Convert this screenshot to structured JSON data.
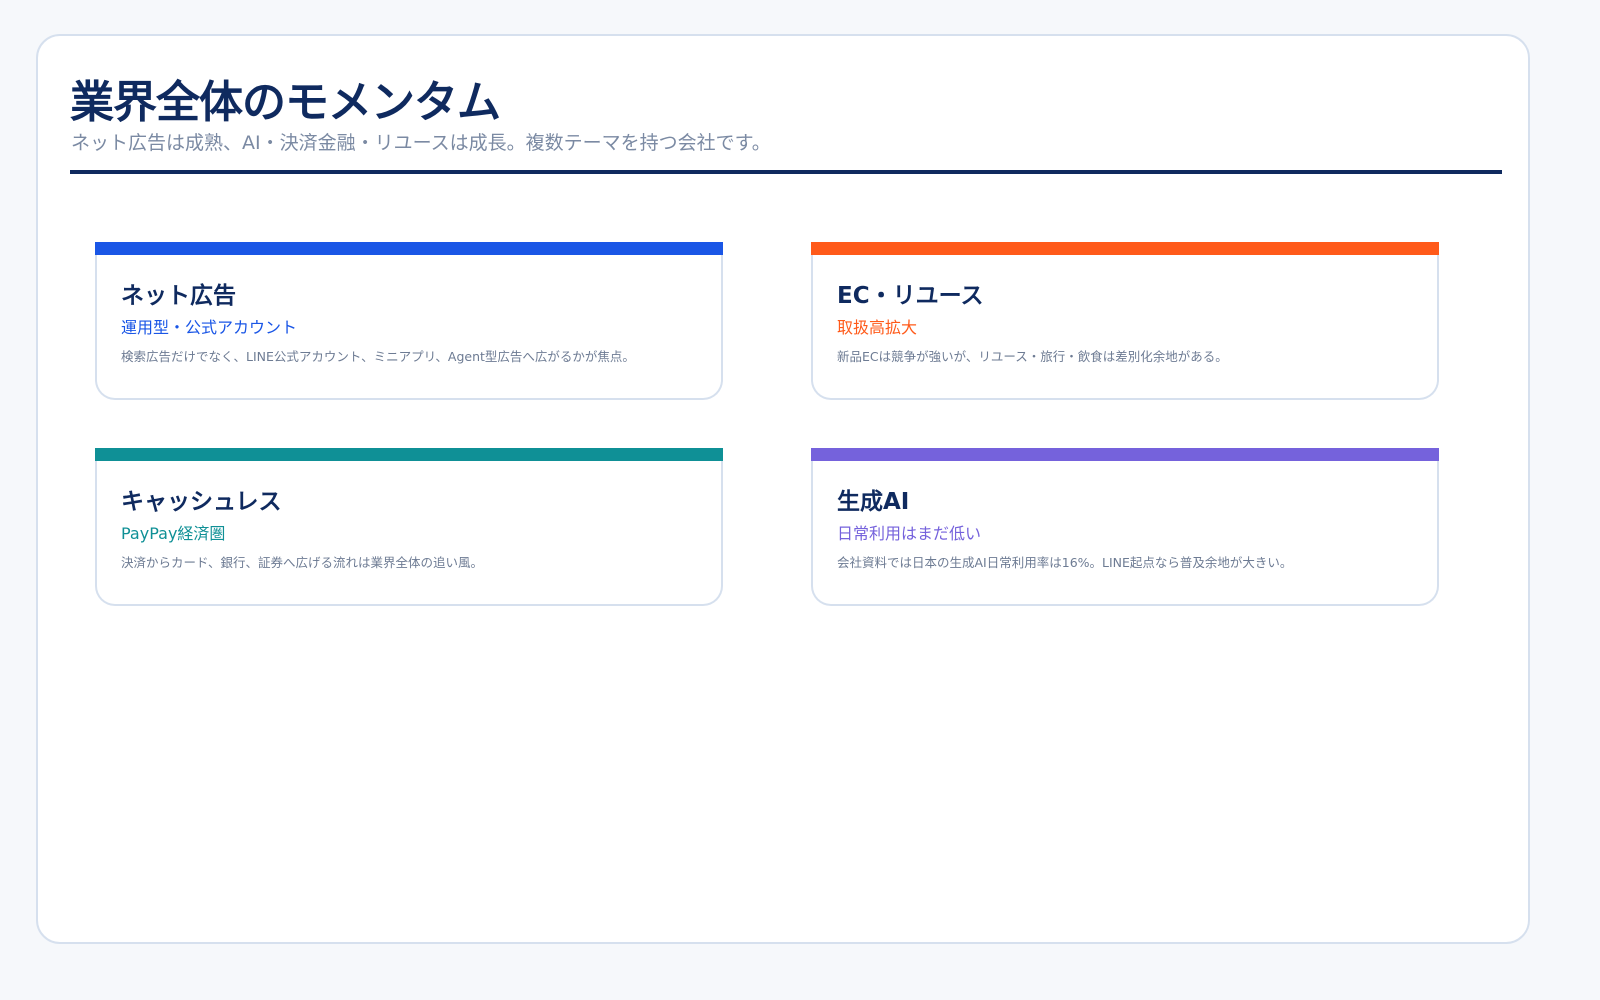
{
  "header": {
    "title": "業界全体のモメンタム",
    "subtitle": "ネット広告は成熟、AI・決済金融・リユースは成長。複数テーマを持つ会社です。"
  },
  "colors": {
    "navy": "#0f2a5f",
    "blue": "#1a56e6",
    "orange": "#ff5a1a",
    "teal": "#0f9096",
    "purple": "#7562dc"
  },
  "cards": [
    {
      "title": "ネット広告",
      "tag": "運用型・公式アカウント",
      "description": "検索広告だけでなく、LINE公式アカウント、ミニアプリ、Agent型広告へ広がるかが焦点。",
      "accent": "#1a56e6"
    },
    {
      "title": "EC・リユース",
      "tag": "取扱高拡大",
      "description": "新品ECは競争が強いが、リユース・旅行・飲食は差別化余地がある。",
      "accent": "#ff5a1a"
    },
    {
      "title": "キャッシュレス",
      "tag": "PayPay経済圏",
      "description": "決済からカード、銀行、証券へ広げる流れは業界全体の追い風。",
      "accent": "#0f9096"
    },
    {
      "title": "生成AI",
      "tag": "日常利用はまだ低い",
      "description": "会社資料では日本の生成AI日常利用率は16%。LINE起点なら普及余地が大きい。",
      "accent": "#7562dc"
    }
  ]
}
